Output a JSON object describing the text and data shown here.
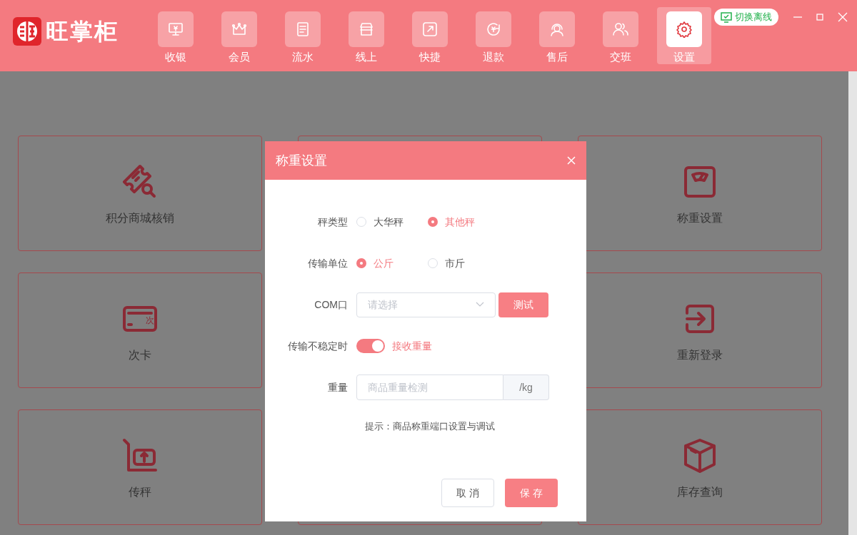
{
  "app": {
    "logo_text": "旺掌柜"
  },
  "nav": [
    {
      "label": "收银",
      "selected": false
    },
    {
      "label": "会员",
      "selected": false
    },
    {
      "label": "流水",
      "selected": false
    },
    {
      "label": "线上",
      "selected": false
    },
    {
      "label": "快捷",
      "selected": false
    },
    {
      "label": "退款",
      "selected": false
    },
    {
      "label": "售后",
      "selected": false
    },
    {
      "label": "交班",
      "selected": false
    },
    {
      "label": "设置",
      "selected": true
    }
  ],
  "offline_button": "切换离线",
  "cards": [
    {
      "label": "积分商城核销"
    },
    {
      "label": "称重设置"
    },
    {
      "label": "次卡",
      "icon_text": "次"
    },
    {
      "label": "重新登录"
    },
    {
      "label": "传秤"
    },
    {
      "label": "库存查询"
    }
  ],
  "dialog": {
    "title": "称重设置",
    "rows": [
      {
        "kind": "radio",
        "label": "秤类型",
        "options": [
          {
            "label": "大华秤",
            "selected": false
          },
          {
            "label": "其他秤",
            "selected": true
          }
        ]
      },
      {
        "kind": "radio",
        "label": "传输单位",
        "options": [
          {
            "label": "公斤",
            "selected": true
          },
          {
            "label": "市斤",
            "selected": false
          }
        ]
      },
      {
        "kind": "select",
        "label": "COM口",
        "placeholder": "请选择",
        "button": "测试"
      },
      {
        "kind": "switch",
        "label": "传输不稳定时",
        "on": true,
        "text": "接收重量"
      },
      {
        "kind": "input",
        "label": "重量",
        "placeholder": "商品重量检测",
        "suffix": "/kg"
      }
    ],
    "hint": "提示：商品称重端口设置与调试",
    "buttons": [
      {
        "label": "取 消",
        "kind": "secondary"
      },
      {
        "label": "保 存",
        "kind": "primary"
      }
    ]
  }
}
